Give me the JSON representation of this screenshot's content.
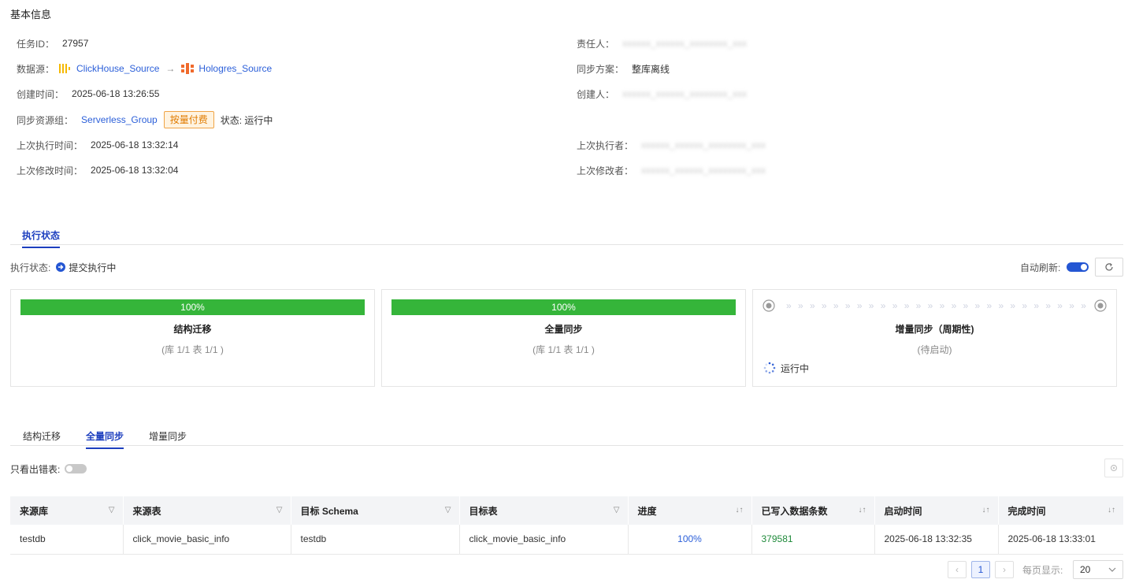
{
  "basic_info": {
    "title": "基本信息",
    "task_id_label": "任务ID：",
    "task_id": "27957",
    "datasource_label": "数据源：",
    "source_name": "ClickHouse_Source",
    "arrow": "→",
    "target_name": "Hologres_Source",
    "created_time_label": "创建时间：",
    "created_time": "2025-06-18 13:26:55",
    "resource_group_label": "同步资源组：",
    "resource_group": "Serverless_Group",
    "billing_badge": "按量付费",
    "status_text": "状态: 运行中",
    "last_exec_time_label": "上次执行时间：",
    "last_exec_time": "2025-06-18 13:32:14",
    "last_modify_time_label": "上次修改时间：",
    "last_modify_time": "2025-06-18 13:32:04",
    "owner_label": "责任人：",
    "owner": "xxxxxx_xxxxxx_xxxxxxxx_xxx",
    "sync_plan_label": "同步方案：",
    "sync_plan": "整库离线",
    "creator_label": "创建人：",
    "creator": "xxxxxx_xxxxxx_xxxxxxxx_xxx",
    "last_executor_label": "上次执行者：",
    "last_executor": "xxxxxx_xxxxxx_xxxxxxxx_xxx",
    "last_modifier_label": "上次修改者：",
    "last_modifier": "xxxxxx_xxxxxx_xxxxxxxx_xxx"
  },
  "exec_tab": {
    "label": "执行状态"
  },
  "exec_status": {
    "label": "执行状态:",
    "value": "提交执行中",
    "auto_refresh_label": "自动刷新:",
    "auto_refresh_on": true
  },
  "stage_cards": {
    "schema": {
      "progress": 1.0,
      "progress_text": "100%",
      "title": "结构迁移",
      "sub": "(库 1/1 表 1/1 )"
    },
    "full": {
      "progress": 1.0,
      "progress_text": "100%",
      "title": "全量同步",
      "sub": "(库 1/1 表 1/1 )"
    },
    "incremental": {
      "title": "增量同步（周期性)",
      "sub": "(待启动)",
      "running": "运行中"
    }
  },
  "detail_tabs": [
    "结构迁移",
    "全量同步",
    "增量同步"
  ],
  "detail_active_tab": 1,
  "filter": {
    "error_only_label": "只看出错表:",
    "error_only_on": false
  },
  "table": {
    "columns": [
      "来源库",
      "来源表",
      "目标 Schema",
      "目标表",
      "进度",
      "已写入数据条数",
      "启动时间",
      "完成时间"
    ],
    "rows": [
      [
        "testdb",
        "click_movie_basic_info",
        "testdb",
        "click_movie_basic_info",
        "100%",
        "379581",
        "2025-06-18 13:32:35",
        "2025-06-18 13:33:01"
      ]
    ]
  },
  "pagination": {
    "current_page": "1",
    "page_size_label": "每页显示:",
    "page_size": "20",
    "prev": "‹",
    "next": "›"
  },
  "colors": {
    "accent": "#1d3fbf",
    "success": "#35b53a",
    "link": "#2b5fd9"
  }
}
